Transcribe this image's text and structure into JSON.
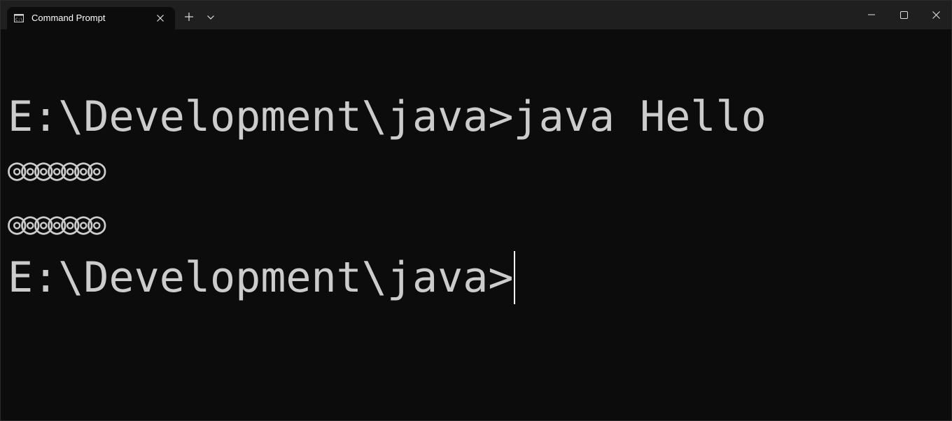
{
  "window": {
    "tab_title": "Command Prompt",
    "tab_icon": "command-prompt-icon",
    "new_tab_icon": "plus-icon",
    "dropdown_icon": "chevron-down-icon",
    "minimize_icon": "minimize-icon",
    "maximize_icon": "maximize-icon",
    "close_icon": "close-icon"
  },
  "terminal": {
    "lines": [
      "E:\\Development\\java>java Hello",
      "◎◎◎◎◎◎◎",
      "◎◎◎◎◎◎◎",
      "E:\\Development\\java>"
    ],
    "text_color": "#cccccc",
    "background_color": "#0c0c0c"
  }
}
